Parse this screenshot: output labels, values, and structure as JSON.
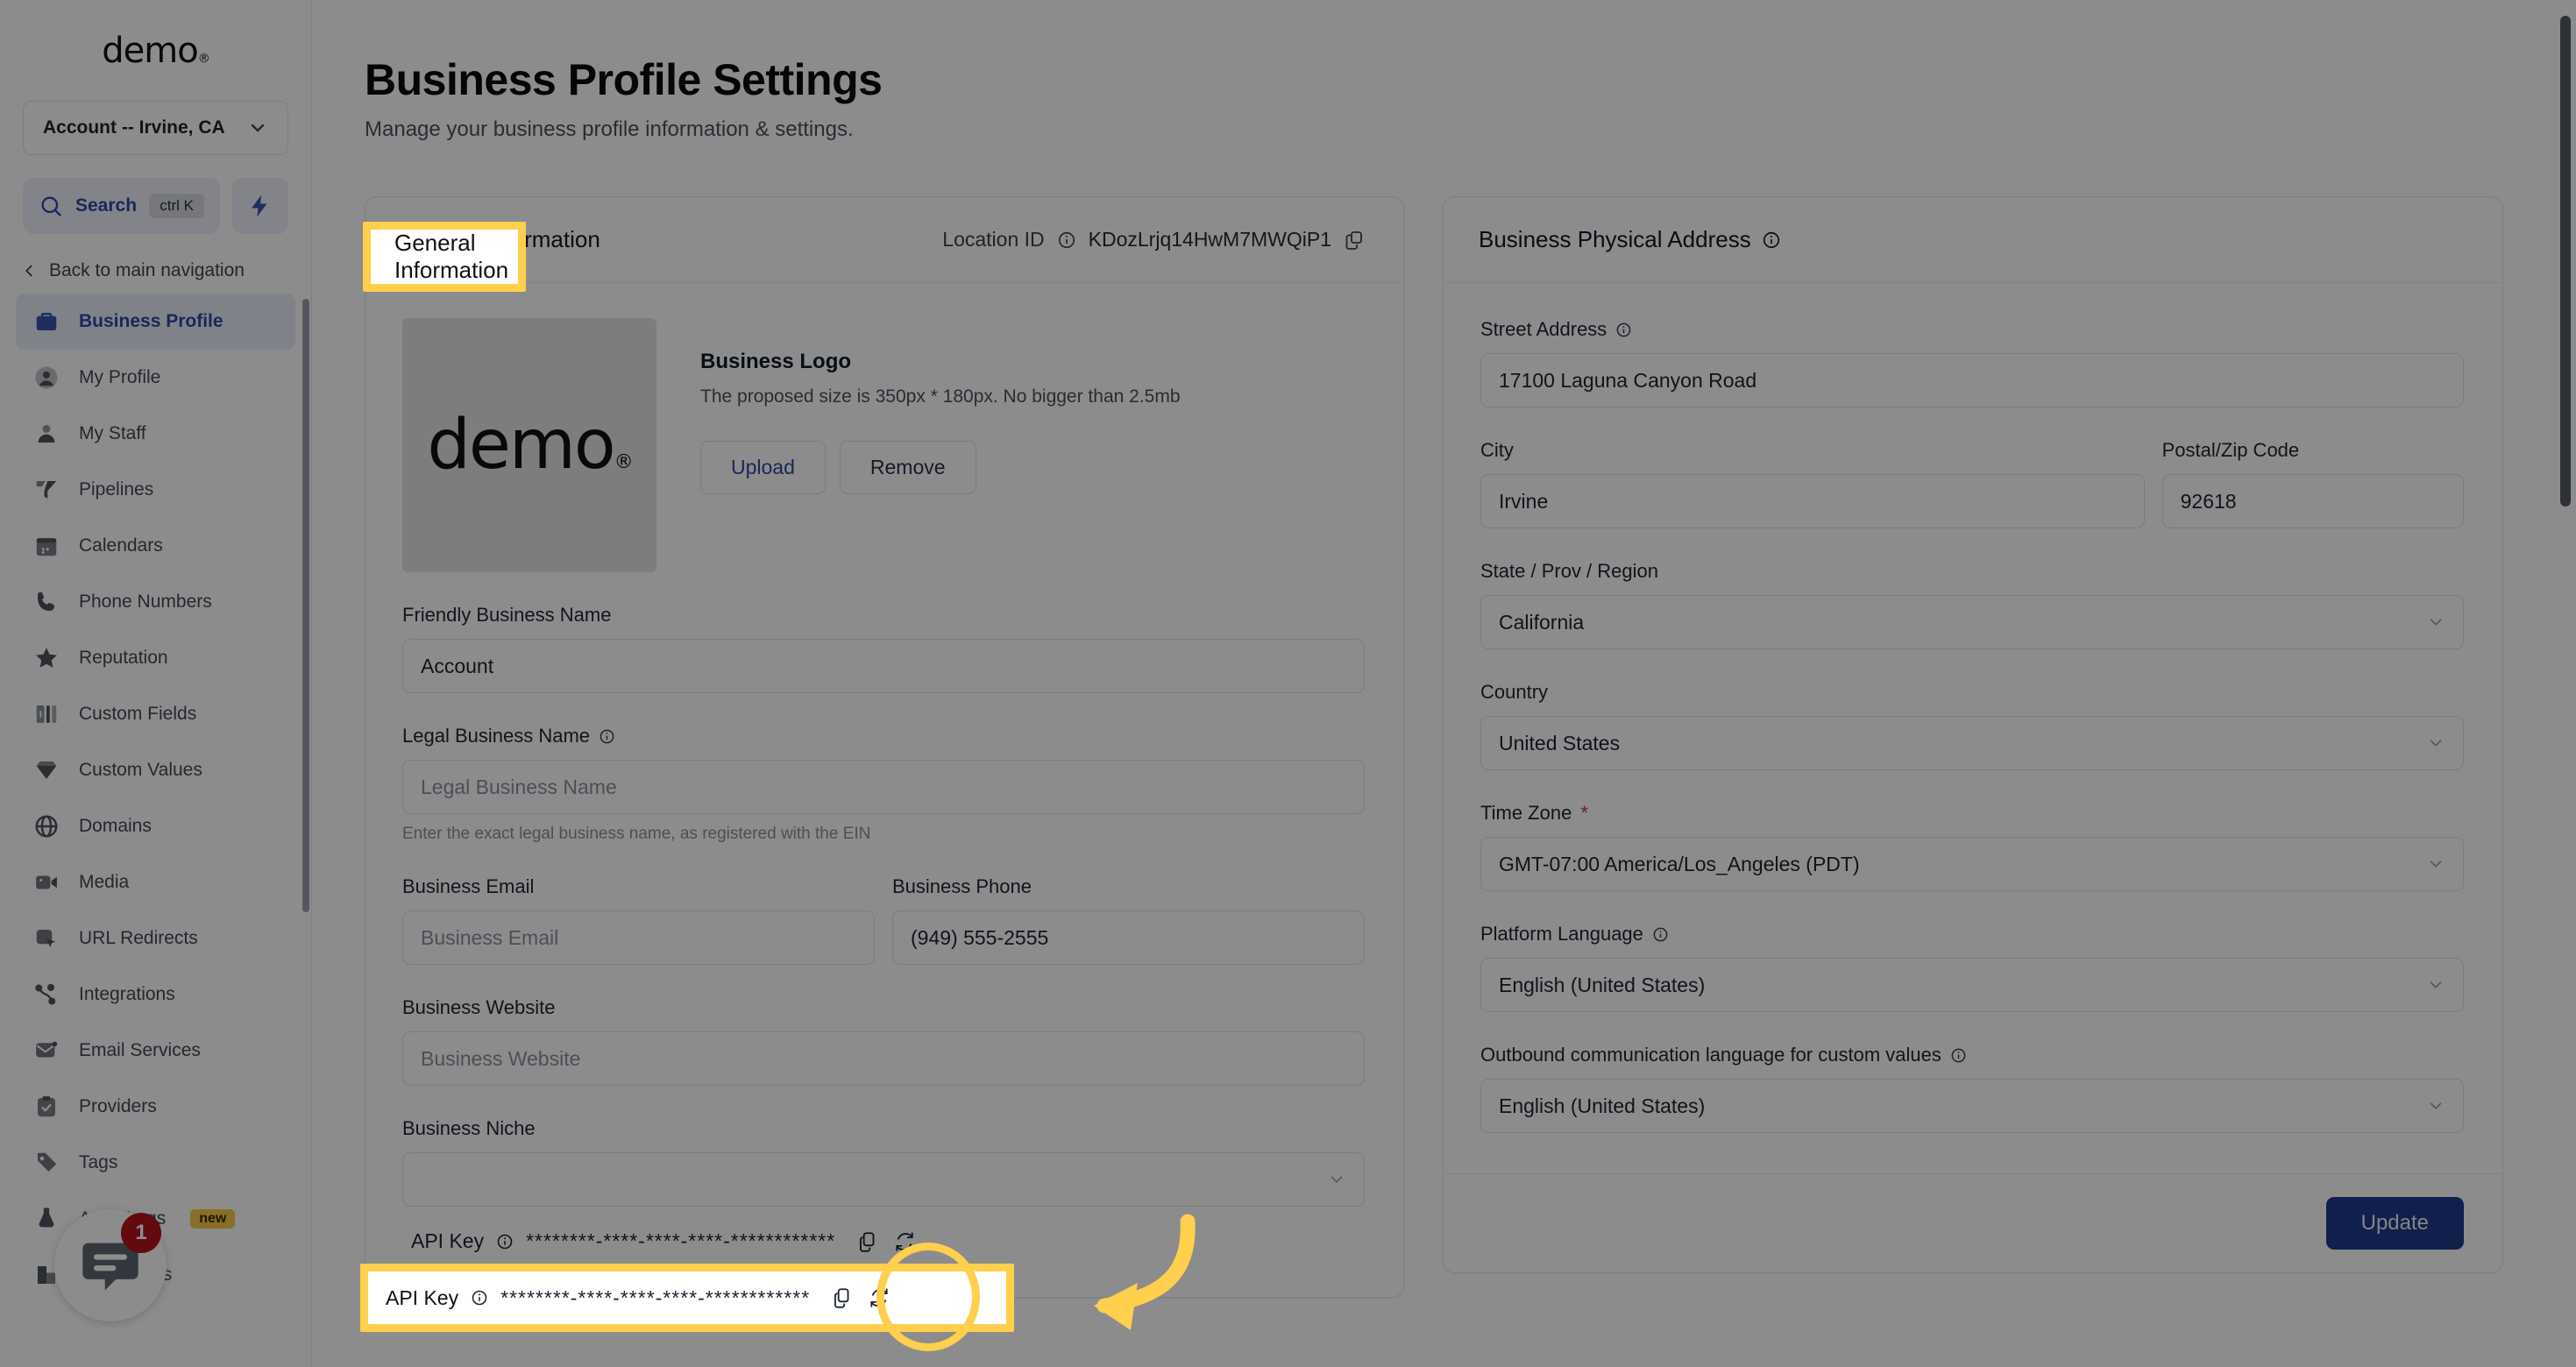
{
  "sidebar": {
    "brand": "demo",
    "brand_mark": "®",
    "account_selector": "Account -- Irvine, CA",
    "search": {
      "label": "Search",
      "shortcut": "ctrl K"
    },
    "back_nav": "Back to main navigation",
    "items": [
      {
        "label": "Business Profile",
        "icon": "briefcase-icon",
        "active": true
      },
      {
        "label": "My Profile",
        "icon": "user-circle-icon",
        "active": false
      },
      {
        "label": "My Staff",
        "icon": "user-icon",
        "active": false
      },
      {
        "label": "Pipelines",
        "icon": "funnel-icon",
        "active": false
      },
      {
        "label": "Calendars",
        "icon": "calendar-icon",
        "active": false
      },
      {
        "label": "Phone Numbers",
        "icon": "phone-icon",
        "active": false
      },
      {
        "label": "Reputation",
        "icon": "star-icon",
        "active": false
      },
      {
        "label": "Custom Fields",
        "icon": "columns-icon",
        "active": false
      },
      {
        "label": "Custom Values",
        "icon": "gem-icon",
        "active": false
      },
      {
        "label": "Domains",
        "icon": "globe-icon",
        "active": false
      },
      {
        "label": "Media",
        "icon": "video-icon",
        "active": false
      },
      {
        "label": "URL Redirects",
        "icon": "cursor-box-icon",
        "active": false
      },
      {
        "label": "Integrations",
        "icon": "share-nodes-icon",
        "active": false
      },
      {
        "label": "Email Services",
        "icon": "envelope-icon",
        "active": false
      },
      {
        "label": "Providers",
        "icon": "clipboard-check-icon",
        "active": false
      },
      {
        "label": "Tags",
        "icon": "tag-icon",
        "active": false
      },
      {
        "label": "Audit Logs",
        "icon": "flask-chart-icon",
        "active": false,
        "badge": "new"
      },
      {
        "label": "Companies",
        "icon": "building-icon",
        "active": false
      }
    ]
  },
  "header": {
    "title": "Business Profile Settings",
    "subtitle": "Manage your business profile information & settings."
  },
  "general": {
    "tab_label": "General Information",
    "location_id_label": "Location ID",
    "location_id_value": "KDozLrjq14HwM7MWQiP1",
    "logo": {
      "mark_text": "demo",
      "mark_sup": "®",
      "title": "Business Logo",
      "hint": "The proposed size is 350px * 180px. No bigger than 2.5mb",
      "upload_label": "Upload",
      "remove_label": "Remove"
    },
    "fields": {
      "friendly_name_label": "Friendly Business Name",
      "friendly_name_value": "Account",
      "legal_name_label": "Legal Business Name",
      "legal_name_placeholder": "Legal Business Name",
      "legal_name_hint": "Enter the exact legal business name, as registered with the EIN",
      "email_label": "Business Email",
      "email_placeholder": "Business Email",
      "phone_label": "Business Phone",
      "phone_value": "(949) 555-2555",
      "website_label": "Business Website",
      "website_placeholder": "Business Website",
      "niche_label": "Business Niche",
      "niche_value": ""
    },
    "api_key": {
      "label": "API Key",
      "masked_value": "********-****-****-****-************",
      "copy_icon": "copy-icon",
      "refresh_icon": "refresh-icon"
    }
  },
  "address": {
    "title": "Business Physical Address",
    "street_label": "Street Address",
    "street_value": "17100 Laguna Canyon Road",
    "city_label": "City",
    "city_value": "Irvine",
    "postal_label": "Postal/Zip Code",
    "postal_value": "92618",
    "state_label": "State / Prov / Region",
    "state_value": "California",
    "country_label": "Country",
    "country_value": "United States",
    "timezone_label": "Time Zone",
    "timezone_required": "*",
    "timezone_value": "GMT-07:00 America/Los_Angeles (PDT)",
    "platform_language_label": "Platform Language",
    "platform_language_value": "English (United States)",
    "outbound_language_label": "Outbound communication language for custom values",
    "outbound_language_value": "English (United States)",
    "update_label": "Update"
  },
  "chat": {
    "unread_count": "1",
    "icon": "chat-bubble-icon"
  },
  "annotation": {
    "highlight_color": "#ffcf4d",
    "highlighted_tab": "General Information",
    "highlighted_row": "API Key",
    "circled_target": "copy-and-refresh-icons",
    "arrow": "curved-arrow-pointing-left"
  },
  "colors": {
    "accent_blue": "#2c49a6",
    "primary_button": "#1e3a8a",
    "highlight_yellow": "#ffcf4d",
    "badge_red": "#b3131d",
    "badge_new": "#f7c948"
  }
}
